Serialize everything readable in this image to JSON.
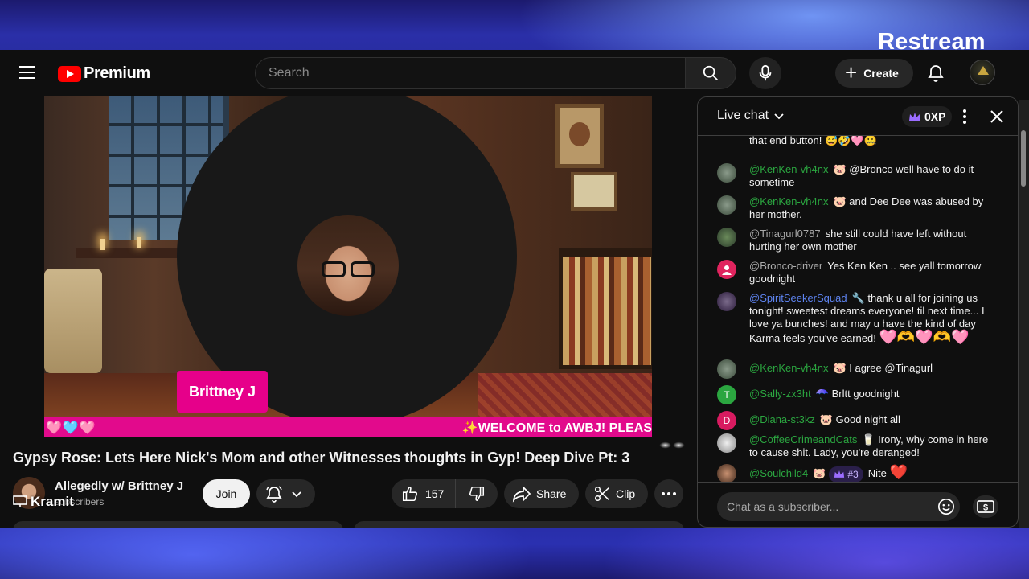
{
  "overlay": {
    "brand": "Restream"
  },
  "header": {
    "logo_text": "Premium",
    "search_placeholder": "Search",
    "create_label": "Create"
  },
  "video": {
    "nameplate": "Brittney J",
    "ticker_left": "🩷🩵🩷",
    "ticker_right": "✨WELCOME to AWBJ! PLEAS",
    "title": "Gypsy Rose: Lets Here Nick's Mom and other Witnesses thoughts in Gyp! Deep Dive Pt: 3"
  },
  "channel": {
    "name": "Allegedly w/ Brittney J",
    "subscribers": "subscribers",
    "join_label": "Join",
    "overlay_tag": "Kramit"
  },
  "actions": {
    "like_count": "157",
    "share_label": "Share",
    "clip_label": "Clip"
  },
  "chat": {
    "title": "Live chat",
    "xp": "0XP",
    "input_placeholder": "Chat as a subscriber...",
    "messages": [
      {
        "author": "",
        "text": "that end button! 😅🤣🩷🤐"
      },
      {
        "author": "@KenKen-vh4nx",
        "badge": "🐷",
        "text": "@Bronco well have to do it sometime"
      },
      {
        "author": "@KenKen-vh4nx",
        "badge": "🐷",
        "text": "and Dee Dee was abused by her mother."
      },
      {
        "author": "@Tinagurl0787",
        "text": "she still could have left without hurting her own mother"
      },
      {
        "author": "@Bronco-driver",
        "text": "Yes Ken Ken .. see yall tomorrow goodnight"
      },
      {
        "author": "@SpiritSeekerSquad",
        "badge": "🔧",
        "text": "thank u all for joining us tonight! sweetest dreams everyone! til next time... I love ya bunches! and may u have the kind of day Karma feels you've earned!",
        "emojis": "🩷🫶🩷🫶🩷"
      },
      {
        "author": "@KenKen-vh4nx",
        "badge": "🐷",
        "text": "I agree @Tinagurl"
      },
      {
        "author": "@Sally-zx3ht",
        "badge": "☂️",
        "avatar_letter": "T",
        "text": "Brltt goodnight"
      },
      {
        "author": "@Diana-st3kz",
        "badge": "🐷",
        "avatar_letter": "D",
        "text": "Good night all"
      },
      {
        "author": "@CoffeeCrimeandCats",
        "badge": "🥛",
        "text": "Irony, why come in here to cause shit. Lady, you're deranged!"
      },
      {
        "author": "@Soulchild4",
        "badge": "🐷",
        "rank": "#3",
        "text": "Nite",
        "emojis": "❤️"
      }
    ]
  },
  "colors": {
    "accent_red": "#ff0000",
    "chat_author_green": "#2ba640",
    "ticker_pink": "#e20a8c"
  }
}
